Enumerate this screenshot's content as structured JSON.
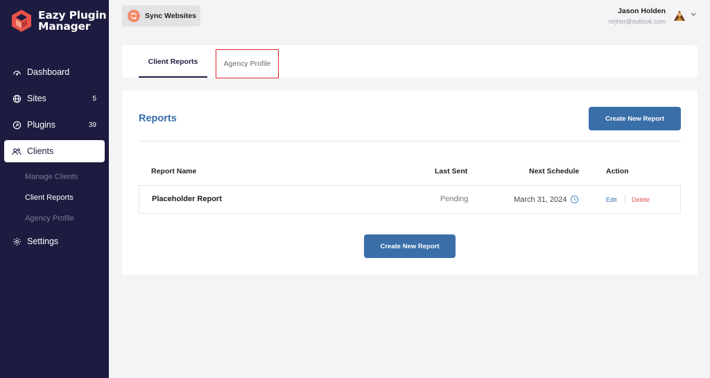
{
  "app": {
    "logo_line1": "Eazy Plugin",
    "logo_line2": "Manager"
  },
  "sidebar": {
    "items": [
      {
        "label": "Dashboard",
        "icon": "dashboard-gauge-icon"
      },
      {
        "label": "Sites",
        "icon": "globe-icon",
        "count": "5"
      },
      {
        "label": "Plugins",
        "icon": "plugin-icon",
        "count": "39"
      },
      {
        "label": "Clients",
        "icon": "users-icon",
        "active": true
      },
      {
        "label": "Settings",
        "icon": "gear-icon"
      }
    ],
    "clients_sub": [
      "Manage Clients",
      "Client Reports",
      "Agency Profile"
    ],
    "current_sub": "Client Reports"
  },
  "header": {
    "sync_label": "Sync Websites",
    "user_name": "Jason Holden",
    "user_email": "nirjhor@outlook.com"
  },
  "tabs": {
    "client_reports": "Client Reports",
    "agency_profile": "Agency Profile",
    "active": "Client Reports",
    "highlighted": "Agency Profile"
  },
  "reports": {
    "title": "Reports",
    "create_label": "Create New Report",
    "columns": [
      "Report Name",
      "Last Sent",
      "Next Schedule",
      "Action"
    ],
    "rows": [
      {
        "name": "Placeholder Report",
        "last_sent": "Pending",
        "next_schedule": "March 31, 2024",
        "edit": "Edit",
        "delete": "Delete"
      }
    ]
  },
  "colors": {
    "sidebar_bg": "#1d1b3f",
    "accent_blue": "#3a6ea9",
    "highlight_red": "#d9262b",
    "delete_red": "#e0554b",
    "sync_orange": "#f08a6c"
  }
}
